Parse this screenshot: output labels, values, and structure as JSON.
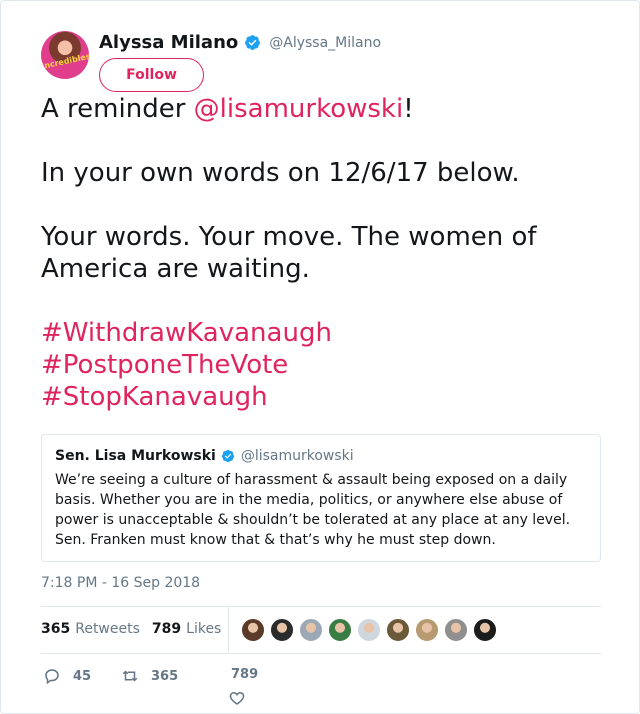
{
  "author": {
    "display_name": "Alyssa Milano",
    "handle": "@Alyssa_Milano",
    "avatar_text": "Incredibles"
  },
  "follow_button": {
    "label": "Follow"
  },
  "tweet": {
    "line1_pre": "A reminder ",
    "line1_mention": "@lisamurkowski",
    "line1_post": "!",
    "line2": "In your own words on 12/6/17 below.",
    "line3": "Your words. Your move. The women of America are waiting.",
    "hashtags": [
      "#WithdrawKavanaugh",
      "#PostponeTheVote",
      "#StopKanavaugh"
    ]
  },
  "quoted_tweet": {
    "display_name": "Sen. Lisa Murkowski",
    "handle": "@lisamurkowski",
    "text": "We’re seeing a culture of harassment & assault being exposed on a daily basis. Whether you are in the media, politics, or anywhere else abuse of power is unacceptable & shouldn’t be tolerated at any place at any level. Sen. Franken must know that & that’s why he must step down."
  },
  "timestamp": "7:18 PM - 16 Sep 2018",
  "stats": {
    "retweets_count": "365",
    "retweets_label": "Retweets",
    "likes_count": "789",
    "likes_label": "Likes"
  },
  "liker_avatars": [
    "#5a3b2a",
    "#2b2b2b",
    "#9ca8b5",
    "#3a7d44",
    "#cfd6dd",
    "#6b5a3a",
    "#b89a70",
    "#8f8f8f",
    "#1c1c1c"
  ],
  "actions": {
    "reply_count": "45",
    "retweet_count": "365",
    "like_count": "789"
  },
  "colors": {
    "accent": "#e0245e",
    "verified": "#1da1f2",
    "secondary_text": "#657786"
  }
}
